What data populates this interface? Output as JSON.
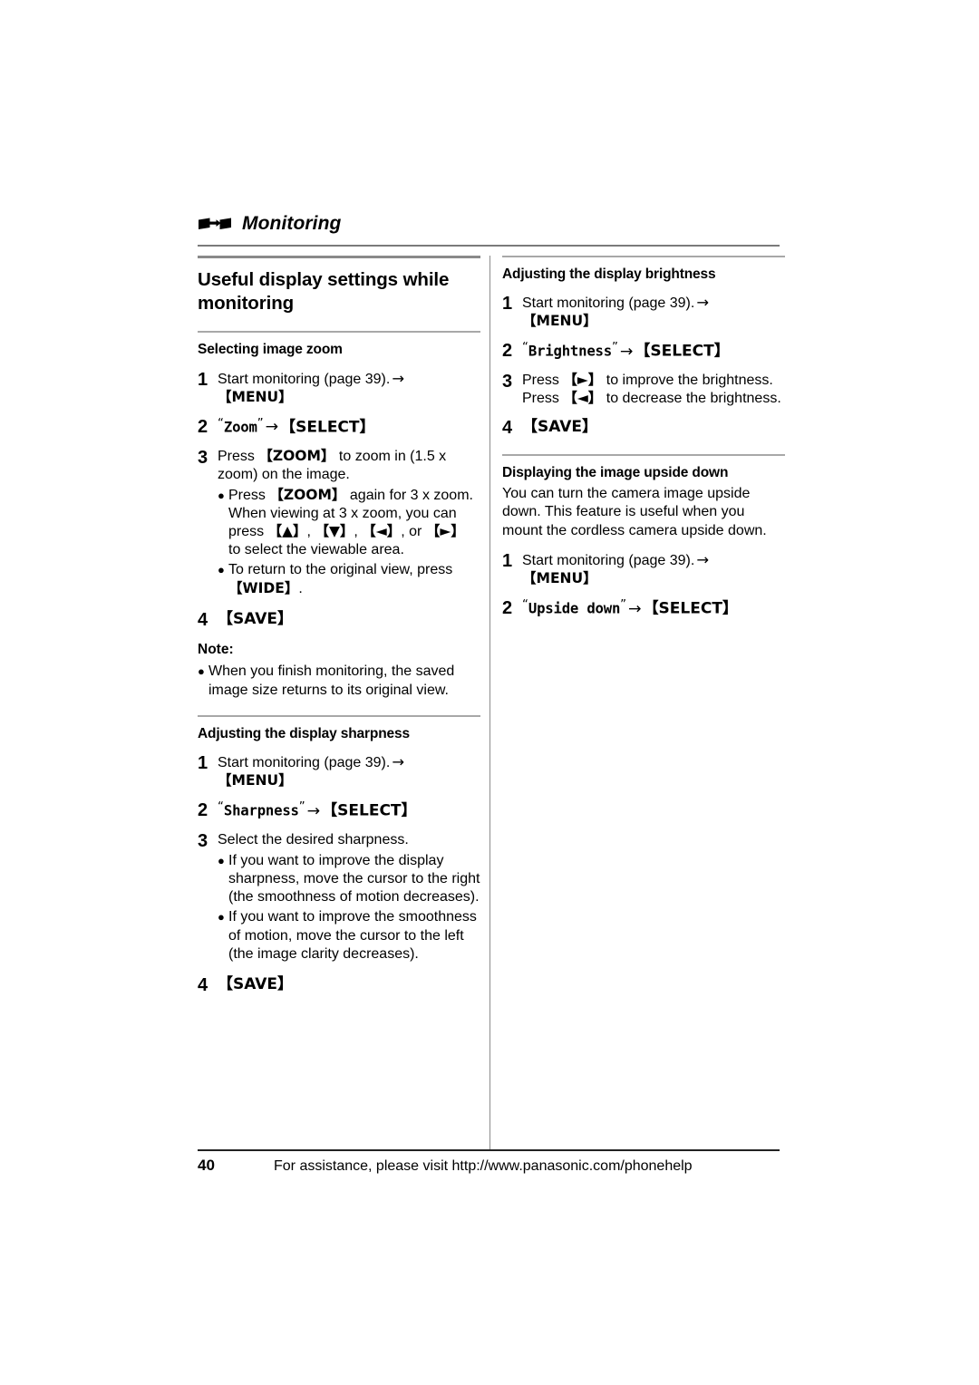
{
  "running_head": {
    "icon": "monitoring-transfer-icon",
    "title": "Monitoring"
  },
  "left_column": {
    "section_title": "Useful display settings while monitoring",
    "subsections": [
      {
        "heading": "Selecting image zoom",
        "steps": [
          {
            "num": "1",
            "text_1": "Start monitoring (page 39).",
            "arrow": "→",
            "key": "【MENU】"
          },
          {
            "num": "2",
            "menu_item": "Zoom",
            "arrow": "→",
            "key": "【SELECT】"
          },
          {
            "num": "3",
            "lead_a": "Press ",
            "key_zoom": "【ZOOM】",
            "lead_b": " to zoom in (1.5 x zoom) on the image.",
            "bullets": [
              {
                "a": "Press ",
                "key": "【ZOOM】",
                "b": " again for 3 x zoom. When viewing at 3 x zoom, you can press ",
                "keys": [
                  "【▲】",
                  "【▼】",
                  "【◄】",
                  "【►】"
                ],
                "c": " to select the viewable area."
              },
              {
                "a": "To return to the original view, press ",
                "key": "【WIDE】",
                "b": "."
              }
            ]
          },
          {
            "num": "4",
            "key": "【SAVE】"
          }
        ],
        "note_label": "Note:",
        "notes": [
          "When you finish monitoring, the saved image size returns to its original view."
        ]
      },
      {
        "heading": "Adjusting the display sharpness",
        "steps": [
          {
            "num": "1",
            "text_1": "Start monitoring (page 39).",
            "arrow": "→",
            "key": "【MENU】"
          },
          {
            "num": "2",
            "menu_item": "Sharpness",
            "arrow": "→",
            "key": "【SELECT】"
          },
          {
            "num": "3",
            "text": "Select the desired sharpness.",
            "bullets": [
              "If you want to improve the display sharpness, move the cursor to the right (the smoothness of motion decreases).",
              "If you want to improve the smoothness of motion, move the cursor to the left (the image clarity decreases)."
            ]
          },
          {
            "num": "4",
            "key": "【SAVE】"
          }
        ]
      }
    ]
  },
  "right_column": {
    "subsections": [
      {
        "heading": "Adjusting the display brightness",
        "steps": [
          {
            "num": "1",
            "text_1": "Start monitoring (page 39).",
            "arrow": "→",
            "key": "【MENU】"
          },
          {
            "num": "2",
            "menu_item": "Brightness",
            "arrow": "→",
            "key": "【SELECT】"
          },
          {
            "num": "3",
            "line1_a": "Press ",
            "line1_key": "【►】",
            "line1_b": " to improve the brightness.",
            "line2_a": "Press ",
            "line2_key": "【◄】",
            "line2_b": " to decrease the brightness."
          },
          {
            "num": "4",
            "key": "【SAVE】"
          }
        ]
      },
      {
        "heading": "Displaying the image upside down",
        "intro": "You can turn the camera image upside down. This feature is useful when you mount the cordless camera upside down.",
        "steps": [
          {
            "num": "1",
            "text_1": "Start monitoring (page 39).",
            "arrow": "→",
            "key": "【MENU】"
          },
          {
            "num": "2",
            "menu_item": "Upside down",
            "arrow": "→",
            "key": "【SELECT】"
          }
        ]
      }
    ]
  },
  "footer": {
    "page_number": "40",
    "text": "For assistance, please visit http://www.panasonic.com/phonehelp"
  },
  "colors": {
    "rule_dark": "#7b7b7b",
    "rule_thick": "#8a8a8a",
    "rule_thin": "#a8a8a8",
    "divider": "#8c8c8c",
    "footer_rule": "#222222",
    "text": "#000000"
  }
}
